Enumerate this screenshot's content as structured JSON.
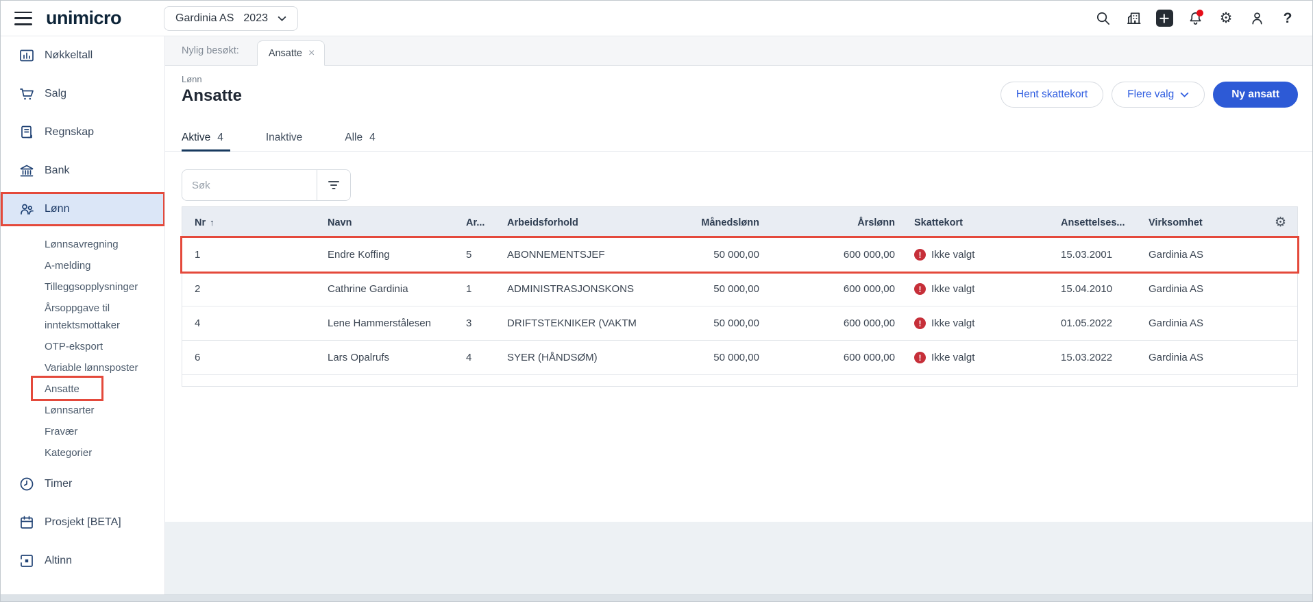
{
  "topbar": {
    "logo_text": "unimicro",
    "company": "Gardinia AS",
    "year": "2023"
  },
  "glyphs": {
    "gear": "⚙",
    "help": "?",
    "close": "×",
    "sort_asc": "↑",
    "alert": "!"
  },
  "sidebar": {
    "main_items": [
      {
        "label": "Nøkkeltall"
      },
      {
        "label": "Salg"
      },
      {
        "label": "Regnskap"
      },
      {
        "label": "Bank"
      },
      {
        "label": "Lønn"
      }
    ],
    "submenu": [
      {
        "label": "Lønnsavregning"
      },
      {
        "label": "A-melding"
      },
      {
        "label": "Tilleggsopplysninger"
      },
      {
        "label": "Årsoppgave til inntektsmottaker"
      },
      {
        "label": "OTP-eksport"
      },
      {
        "label": "Variable lønnsposter"
      },
      {
        "label": "Ansatte"
      },
      {
        "label": "Lønnsarter"
      },
      {
        "label": "Fravær"
      },
      {
        "label": "Kategorier"
      }
    ],
    "bottom_items": [
      {
        "label": "Timer"
      },
      {
        "label": "Prosjekt [BETA]"
      },
      {
        "label": "Altinn"
      }
    ]
  },
  "recent_bar": {
    "label": "Nylig besøkt:",
    "tab": "Ansatte"
  },
  "page_header": {
    "breadcrumb": "Lønn",
    "title": "Ansatte",
    "actions": {
      "hent_skattekort": "Hent skattekort",
      "flere_valg": "Flere valg",
      "ny_ansatt": "Ny ansatt"
    }
  },
  "filter_tabs": {
    "aktive_label": "Aktive",
    "aktive_count": "4",
    "inaktive_label": "Inaktive",
    "alle_label": "Alle",
    "alle_count": "4"
  },
  "search": {
    "placeholder": "Søk"
  },
  "table": {
    "headers": {
      "nr": "Nr",
      "navn": "Navn",
      "ar": "Ar...",
      "arbeidsforhold": "Arbeidsforhold",
      "manedslonn": "Månedslønn",
      "arslonn": "Årslønn",
      "skattekort": "Skattekort",
      "ansettelsesdato": "Ansettelses...",
      "virksomhet": "Virksomhet"
    },
    "rows": [
      {
        "nr": "1",
        "navn": "Endre Koffing",
        "ar": "5",
        "arbeidsforhold": "ABONNEMENTSJEF",
        "manedslonn": "50 000,00",
        "arslonn": "600 000,00",
        "skattekort": "Ikke valgt",
        "ansettelsesdato": "15.03.2001",
        "virksomhet": "Gardinia AS"
      },
      {
        "nr": "2",
        "navn": "Cathrine Gardinia",
        "ar": "1",
        "arbeidsforhold": "ADMINISTRASJONSKONS",
        "manedslonn": "50 000,00",
        "arslonn": "600 000,00",
        "skattekort": "Ikke valgt",
        "ansettelsesdato": "15.04.2010",
        "virksomhet": "Gardinia AS"
      },
      {
        "nr": "4",
        "navn": "Lene Hammerstålesen",
        "ar": "3",
        "arbeidsforhold": "DRIFTSTEKNIKER (VAKTM",
        "manedslonn": "50 000,00",
        "arslonn": "600 000,00",
        "skattekort": "Ikke valgt",
        "ansettelsesdato": "01.05.2022",
        "virksomhet": "Gardinia AS"
      },
      {
        "nr": "6",
        "navn": "Lars Opalrufs",
        "ar": "4",
        "arbeidsforhold": "SYER (HÅNDSØM)",
        "manedslonn": "50 000,00",
        "arslonn": "600 000,00",
        "skattekort": "Ikke valgt",
        "ansettelsesdato": "15.03.2022",
        "virksomhet": "Gardinia AS"
      }
    ]
  },
  "colors": {
    "accent_blue": "#2d5ad6",
    "annotation_red": "#e4493b",
    "alert_red": "#c62f39",
    "notification_red": "#e60d18",
    "navy_icon": "#214375",
    "table_header_bg": "#e9edf3",
    "active_item_bg": "#dbe6f7"
  }
}
